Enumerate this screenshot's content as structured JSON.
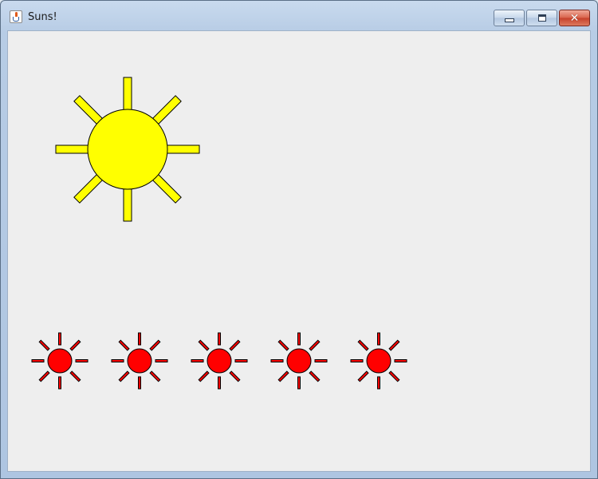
{
  "window": {
    "title": "Suns!",
    "app_icon": "java-cup-icon",
    "controls": {
      "minimize_icon": "minimize-icon",
      "maximize_icon": "maximize-icon",
      "close_icon": "close-icon"
    }
  },
  "canvas": {
    "background": "#eeeeee",
    "big_sun": {
      "fill": "#ffff00",
      "stroke": "#000000",
      "rays": 8
    },
    "small_suns": {
      "count": 5,
      "fill": "#ff0000",
      "stroke": "#000000",
      "rays": 8
    }
  }
}
